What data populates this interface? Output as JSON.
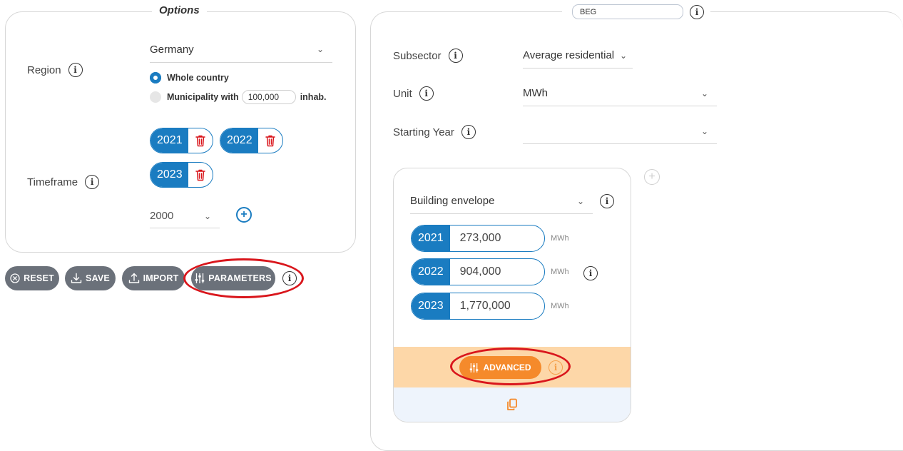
{
  "options": {
    "title": "Options",
    "region": {
      "label": "Region",
      "country": "Germany",
      "radio_whole": "Whole country",
      "radio_muni_prefix": "Municipality with",
      "muni_value": "100,000",
      "radio_muni_suffix": "inhab."
    },
    "timeframe": {
      "label": "Timeframe",
      "years": [
        "2021",
        "2022",
        "2023"
      ],
      "add_year_value": "2000"
    }
  },
  "toolbar": {
    "reset": "RESET",
    "save": "SAVE",
    "import": "IMPORT",
    "parameters": "PARAMETERS"
  },
  "right_panel": {
    "name_value": "BEG",
    "subsector": {
      "label": "Subsector",
      "value": "Average residential"
    },
    "unit": {
      "label": "Unit",
      "value": "MWh"
    },
    "starting_year": {
      "label": "Starting Year",
      "value": ""
    },
    "card": {
      "category": "Building envelope",
      "rows": [
        {
          "year": "2021",
          "value": "273,000",
          "unit": "MWh"
        },
        {
          "year": "2022",
          "value": "904,000",
          "unit": "MWh"
        },
        {
          "year": "2023",
          "value": "1,770,000",
          "unit": "MWh"
        }
      ],
      "advanced": "ADVANCED"
    }
  },
  "colors": {
    "primary": "#1a7cc1",
    "button_grey": "#6b717a",
    "advanced_orange": "#f58a2b",
    "advanced_band": "#fdd7a8",
    "copy_band": "#eef4fc",
    "delete_red": "#d9161c",
    "annotation_red": "#d9161c"
  }
}
